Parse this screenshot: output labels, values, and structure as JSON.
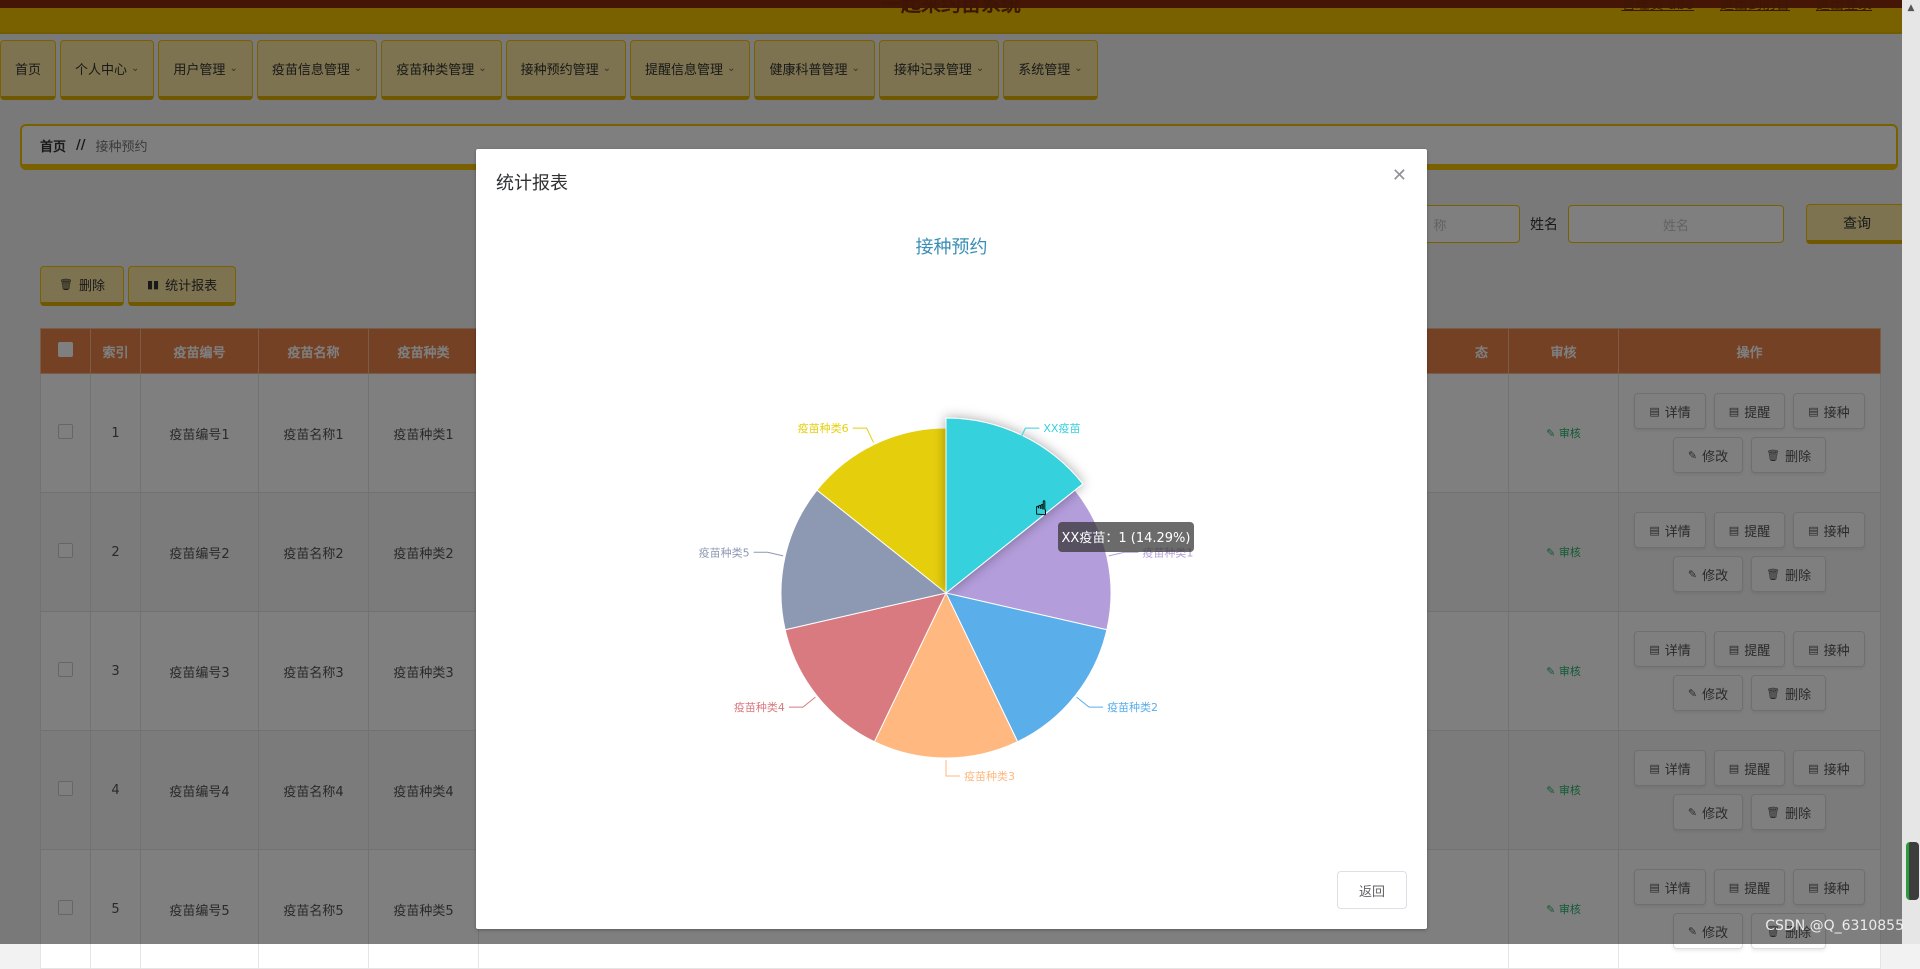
{
  "app": {
    "title": "一起来约苗系统",
    "links": [
      "管理员 abo",
      "退出到前台",
      "退出登录"
    ]
  },
  "nav": [
    {
      "label": "首页",
      "dropdown": false
    },
    {
      "label": "个人中心",
      "dropdown": true
    },
    {
      "label": "用户管理",
      "dropdown": true
    },
    {
      "label": "疫苗信息管理",
      "dropdown": true
    },
    {
      "label": "疫苗种类管理",
      "dropdown": true
    },
    {
      "label": "接种预约管理",
      "dropdown": true
    },
    {
      "label": "提醒信息管理",
      "dropdown": true
    },
    {
      "label": "健康科普管理",
      "dropdown": true
    },
    {
      "label": "接种记录管理",
      "dropdown": true
    },
    {
      "label": "系统管理",
      "dropdown": true
    }
  ],
  "breadcrumb": {
    "home": "首页",
    "sep": "//",
    "current": "接种预约"
  },
  "search": {
    "partial_placeholder": "称",
    "name_label": "姓名",
    "name_placeholder": "姓名",
    "query_label": "查询"
  },
  "actions": {
    "delete_label": "删除",
    "report_label": "统计报表"
  },
  "table": {
    "headers": {
      "index": "索引",
      "code": "疫苗编号",
      "name": "疫苗名称",
      "type": "疫苗种类",
      "status": "态",
      "audit": "审核",
      "ops": "操作"
    },
    "rows": [
      {
        "index": "1",
        "code": "疫苗编号1",
        "name": "疫苗名称1",
        "type": "疫苗种类1",
        "audit": "审核"
      },
      {
        "index": "2",
        "code": "疫苗编号2",
        "name": "疫苗名称2",
        "type": "疫苗种类2",
        "audit": "审核"
      },
      {
        "index": "3",
        "code": "疫苗编号3",
        "name": "疫苗名称3",
        "type": "疫苗种类3",
        "audit": "审核"
      },
      {
        "index": "4",
        "code": "疫苗编号4",
        "name": "疫苗名称4",
        "type": "疫苗种类4",
        "audit": "审核"
      },
      {
        "index": "5",
        "code": "疫苗编号5",
        "name": "疫苗名称5",
        "type": "疫苗种类5",
        "audit": "审核"
      }
    ],
    "op_labels": {
      "detail": "详情",
      "remind": "提醒",
      "vaccinate": "接种",
      "edit": "修改",
      "delete": "删除"
    }
  },
  "dialog": {
    "title": "统计报表",
    "close_icon": "close-icon",
    "return_label": "返回",
    "tooltip": "XX疫苗：1 (14.29%)"
  },
  "chart_data": {
    "type": "pie",
    "title": "接种预约",
    "series": [
      {
        "name": "XX疫苗",
        "value": 1,
        "color": "#36d1dc",
        "highlighted": true
      },
      {
        "name": "疫苗种类1",
        "value": 1,
        "color": "#b39ddb"
      },
      {
        "name": "疫苗种类2",
        "value": 1,
        "color": "#5aaeea"
      },
      {
        "name": "疫苗种类3",
        "value": 1,
        "color": "#ffb980"
      },
      {
        "name": "疫苗种类4",
        "value": 1,
        "color": "#d87a80"
      },
      {
        "name": "疫苗种类5",
        "value": 1,
        "color": "#8d98b3"
      },
      {
        "name": "疫苗种类6",
        "value": 1,
        "color": "#e5cf0d"
      }
    ]
  },
  "watermark": "CSDN @Q_6310855"
}
